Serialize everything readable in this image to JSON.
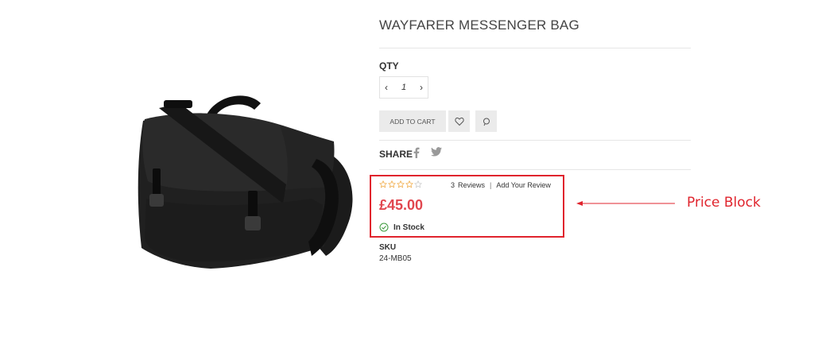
{
  "product": {
    "title": "WAYFARER MESSENGER BAG",
    "image_alt": "messenger-bag-photo",
    "qty_label": "QTY",
    "qty_value": "1",
    "add_to_cart_label": "ADD TO CART",
    "share_label": "SHARE",
    "rating": 0,
    "rating_max": 5,
    "reviews_count": "3",
    "reviews_label": "Reviews",
    "reviews_separator": "|",
    "add_review_label": "Add Your Review",
    "price": "£45.00",
    "stock_status": "In Stock",
    "sku_label": "SKU",
    "sku_value": "24-MB05"
  },
  "icons": {
    "qty_decrease": "chevron-left-icon",
    "qty_increase": "chevron-right-icon",
    "wishlist": "heart-icon",
    "compare": "compare-icon",
    "facebook": "facebook-icon",
    "twitter": "twitter-icon",
    "stock": "check-circle-icon",
    "stars": "star-outline-icon"
  },
  "annotation": {
    "label": "Price Block"
  },
  "colors": {
    "price": "#e1474f",
    "annotation": "#e0242d",
    "stars": "#f0a840",
    "stock_check": "#3c9a3c",
    "button_bg": "#ebebeb"
  }
}
